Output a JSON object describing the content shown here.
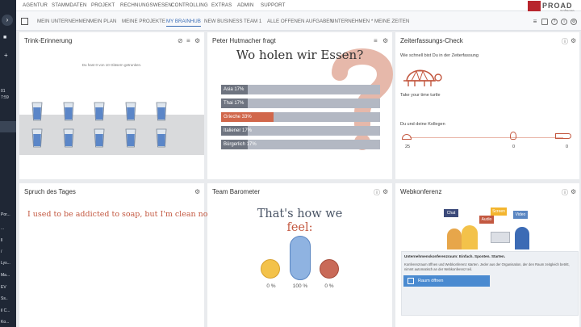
{
  "sidebar": {
    "items": [
      "01",
      "7:59",
      "Por...",
      "",
      "...",
      "ll",
      "/",
      "Lys...",
      "Ma...",
      "EV",
      "Ss..",
      "il C...",
      "Ko..."
    ]
  },
  "top_menu": [
    "AGENTUR",
    "STAMMDATEN",
    "PROJEKT",
    "RECHNUNGSWESEN",
    "CONTROLLING",
    "EXTRAS",
    "ADMIN",
    "SUPPORT"
  ],
  "tabs": [
    "MEIN UNTERNEHMEN",
    "MEIN PLAN",
    "MEINE PROJEKTE",
    "MY BRAINHUB",
    "NEW BUSINESS",
    "TEAM 1",
    "ALLE OFFENEN AUFGABEN",
    "UNTERNEHMEN *",
    "MEINE ZEITEN"
  ],
  "active_tab": "MY BRAINHUB",
  "logo": {
    "text": "PROAD",
    "sub": "Software"
  },
  "trink": {
    "title": "Trink-Erinnerung",
    "message": "Du hast 0 von 10 Gläsern getrunken.",
    "glasses_total": 10,
    "glasses_drunk": 0
  },
  "poll": {
    "title": "Peter Hutmacher fragt",
    "question": "Wo holen wir Essen?",
    "options": [
      {
        "label": "Asia 17%",
        "value": 17
      },
      {
        "label": "Thai 17%",
        "value": 17
      },
      {
        "label": "Grieche 33%",
        "value": 33,
        "highlight": true
      },
      {
        "label": "Italiener 17%",
        "value": 17
      },
      {
        "label": "Bürgerlich 17%",
        "value": 17
      }
    ]
  },
  "zeit": {
    "title": "Zeiterfassungs-Check",
    "question": "Wie schnell bist Du in der Zeiterfassung",
    "result": "Take your time turtle",
    "kollegen": "Du und deine Kollegen",
    "counts": [
      "25",
      "0",
      "0"
    ]
  },
  "spruch": {
    "title": "Spruch des Tages",
    "text": "I used to be addicted to soap, but I'm clean now."
  },
  "baro": {
    "title": "Team Barometer",
    "line1": "That's how we",
    "line2": "feel:",
    "values": [
      "0 %",
      "100 %",
      "0 %"
    ]
  },
  "webko": {
    "title": "Webkonferenz",
    "labels": [
      "Chat",
      "Screen",
      "Audio",
      "Video"
    ],
    "box_title": "Unternehmenskonferenzraum: Einfach. Sponten. Starten.",
    "box_text": "Konferenzraum öffnen und Webkonferenz starten. Jeder aus der Organisation, der den Raum zeitgleich betritt, nimmt automatisch an der Webkonferenz teil.",
    "button": "Raum öffnen"
  },
  "colors": {
    "accent": "#3b6db5",
    "highlight": "#d1674b",
    "sidebar": "#1f2735"
  }
}
